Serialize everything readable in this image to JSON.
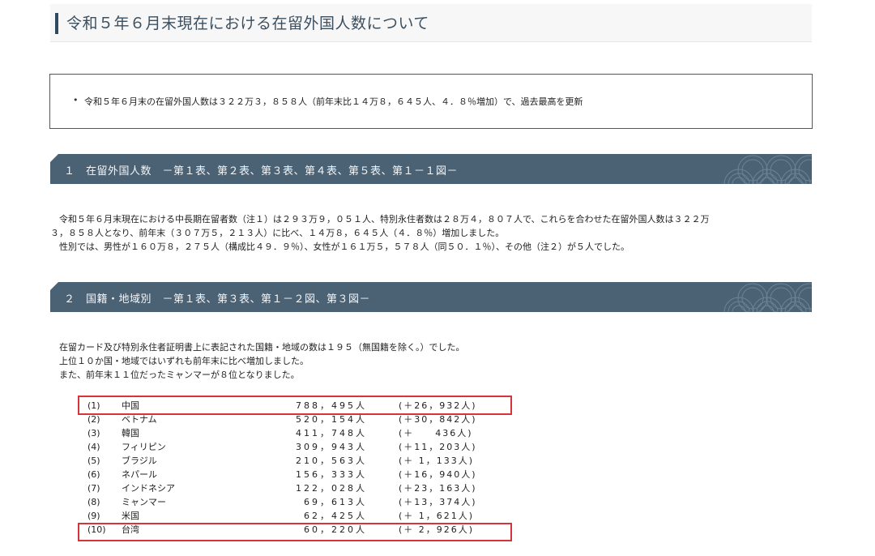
{
  "page_title": "令和５年６月末現在における在留外国人数について",
  "summary": {
    "text": "令和５年６月末の在留外国人数は３２２万３，８５８人（前年末比１４万８，６４５人、４．８％増加）で、過去最高を更新"
  },
  "sections": [
    {
      "heading": "１　在留外国人数　－第１表、第２表、第３表、第４表、第５表、第１－１図－",
      "paragraphs": [
        "　令和５年６月末現在における中長期在留者数（注１）は２９３万９，０５１人、特別永住者数は２８万４，８０７人で、これらを合わせた在留外国人数は３２２万",
        "３，８５８人となり、前年末（３０７万５，２１３人）に比べ、１４万８，６４５人（４．８％）増加しました。",
        "　性別では、男性が１６０万８，２７５人（構成比４９．９％）、女性が１６１万５，５７８人（同５０．１％）、その他（注２）が５人でした。"
      ]
    },
    {
      "heading": "２　国籍・地域別　－第１表、第３表、第１－２図、第３図－",
      "paragraphs": [
        "　在留カード及び特別永住者証明書上に表記された国籍・地域の数は１９５（無国籍を除く。）でした。",
        "　上位１０か国・地域ではいずれも前年末に比べ増加しました。",
        "　また、前年末１１位だったミャンマーが８位となりました。"
      ]
    }
  ],
  "countries": [
    {
      "rank": "(1)",
      "name": "中国",
      "count": "788，495人",
      "change": "(＋26，932人)"
    },
    {
      "rank": "(2)",
      "name": "ベトナム",
      "count": "520，154人",
      "change": "(＋30，842人)"
    },
    {
      "rank": "(3)",
      "name": "韓国",
      "count": "411，748人",
      "change": "(＋　　436人)"
    },
    {
      "rank": "(4)",
      "name": "フィリピン",
      "count": "309，943人",
      "change": "(＋11，203人)"
    },
    {
      "rank": "(5)",
      "name": "ブラジル",
      "count": "210，563人",
      "change": "(＋ 1，133人)"
    },
    {
      "rank": "(6)",
      "name": "ネパール",
      "count": "156，333人",
      "change": "(＋16，940人)"
    },
    {
      "rank": "(7)",
      "name": "インドネシア",
      "count": "122，028人",
      "change": "(＋23，163人)"
    },
    {
      "rank": "(8)",
      "name": "ミャンマー",
      "count": "69，613人",
      "change": "(＋13，374人)"
    },
    {
      "rank": "(9)",
      "name": "米国",
      "count": "62，425人",
      "change": "(＋ 1，621人)"
    },
    {
      "rank": "(10)",
      "name": "台湾",
      "count": "60，220人",
      "change": "(＋ 2，926人)"
    }
  ],
  "colors": {
    "section_bar": "#4b6275",
    "highlight_border": "#d6333a",
    "title_accent": "#2f4a5f"
  }
}
